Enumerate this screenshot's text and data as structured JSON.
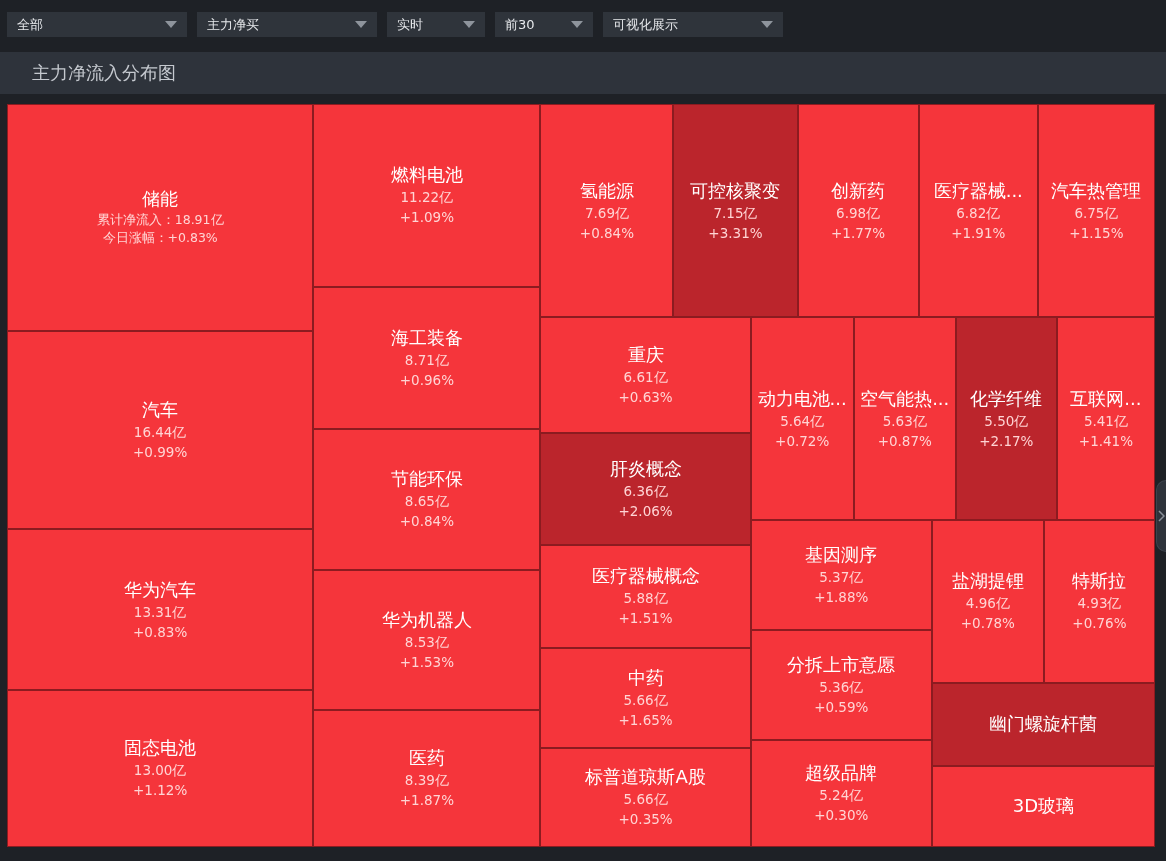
{
  "filters": [
    {
      "label": "全部"
    },
    {
      "label": "主力净买"
    },
    {
      "label": "实时"
    },
    {
      "label": "前30"
    },
    {
      "label": "可视化展示"
    }
  ],
  "panel": {
    "title": "主力净流入分布图"
  },
  "treemap": {
    "tiles": [
      {
        "kind": "detailed",
        "name": "储能",
        "inflow": "累计净流入：18.91亿",
        "change": "今日涨幅：+0.83%",
        "color": "#f5353b"
      },
      {
        "kind": "basic",
        "name": "汽车",
        "inflow": "16.44亿",
        "change": "+0.99%",
        "color": "#f5353b"
      },
      {
        "kind": "basic",
        "name": "华为汽车",
        "inflow": "13.31亿",
        "change": "+0.83%",
        "color": "#f5353b"
      },
      {
        "kind": "basic",
        "name": "固态电池",
        "inflow": "13.00亿",
        "change": "+1.12%",
        "color": "#f5353b"
      },
      {
        "kind": "basic",
        "name": "燃料电池",
        "inflow": "11.22亿",
        "change": "+1.09%",
        "color": "#f5353b"
      },
      {
        "kind": "basic",
        "name": "海工装备",
        "inflow": "8.71亿",
        "change": "+0.96%",
        "color": "#f5353b"
      },
      {
        "kind": "basic",
        "name": "节能环保",
        "inflow": "8.65亿",
        "change": "+0.84%",
        "color": "#f5353b"
      },
      {
        "kind": "basic",
        "name": "华为机器人",
        "inflow": "8.53亿",
        "change": "+1.53%",
        "color": "#f5353b"
      },
      {
        "kind": "basic",
        "name": "医药",
        "inflow": "8.39亿",
        "change": "+1.87%",
        "color": "#f5353b"
      },
      {
        "kind": "basic",
        "name": "氢能源",
        "inflow": "7.69亿",
        "change": "+0.84%",
        "color": "#f5353b"
      },
      {
        "kind": "basic",
        "name": "可控核聚变",
        "inflow": "7.15亿",
        "change": "+3.31%",
        "color": "#bb252c"
      },
      {
        "kind": "basic",
        "name": "创新药",
        "inflow": "6.98亿",
        "change": "+1.77%",
        "color": "#f5353b"
      },
      {
        "kind": "basic",
        "name": "医疗器械...",
        "inflow": "6.82亿",
        "change": "+1.91%",
        "color": "#f5353b"
      },
      {
        "kind": "basic",
        "name": "汽车热管理",
        "inflow": "6.75亿",
        "change": "+1.15%",
        "color": "#f5353b"
      },
      {
        "kind": "basic",
        "name": "重庆",
        "inflow": "6.61亿",
        "change": "+0.63%",
        "color": "#f5353b"
      },
      {
        "kind": "basic",
        "name": "肝炎概念",
        "inflow": "6.36亿",
        "change": "+2.06%",
        "color": "#bb252c"
      },
      {
        "kind": "basic",
        "name": "医疗器械概念",
        "inflow": "5.88亿",
        "change": "+1.51%",
        "color": "#f5353b"
      },
      {
        "kind": "basic",
        "name": "中药",
        "inflow": "5.66亿",
        "change": "+1.65%",
        "color": "#f5353b"
      },
      {
        "kind": "basic",
        "name": "标普道琼斯A股",
        "inflow": "5.66亿",
        "change": "+0.35%",
        "color": "#f5353b"
      },
      {
        "kind": "basic",
        "name": "动力电池...",
        "inflow": "5.64亿",
        "change": "+0.72%",
        "color": "#f5353b"
      },
      {
        "kind": "basic",
        "name": "空气能热...",
        "inflow": "5.63亿",
        "change": "+0.87%",
        "color": "#f5353b"
      },
      {
        "kind": "basic",
        "name": "化学纤维",
        "inflow": "5.50亿",
        "change": "+2.17%",
        "color": "#bb252c"
      },
      {
        "kind": "basic",
        "name": "互联网...",
        "inflow": "5.41亿",
        "change": "+1.41%",
        "color": "#f5353b"
      },
      {
        "kind": "basic",
        "name": "基因测序",
        "inflow": "5.37亿",
        "change": "+1.88%",
        "color": "#f5353b"
      },
      {
        "kind": "basic",
        "name": "分拆上市意愿",
        "inflow": "5.36亿",
        "change": "+0.59%",
        "color": "#f5353b"
      },
      {
        "kind": "basic",
        "name": "超级品牌",
        "inflow": "5.24亿",
        "change": "+0.30%",
        "color": "#f5353b"
      },
      {
        "kind": "basic",
        "name": "盐湖提锂",
        "inflow": "4.96亿",
        "change": "+0.78%",
        "color": "#f5353b"
      },
      {
        "kind": "basic",
        "name": "特斯拉",
        "inflow": "4.93亿",
        "change": "+0.76%",
        "color": "#f5353b"
      },
      {
        "kind": "name_only",
        "name": "幽门螺旋杆菌",
        "color": "#bb252c"
      },
      {
        "kind": "name_only",
        "name": "3D玻璃",
        "color": "#f5353b"
      }
    ]
  }
}
